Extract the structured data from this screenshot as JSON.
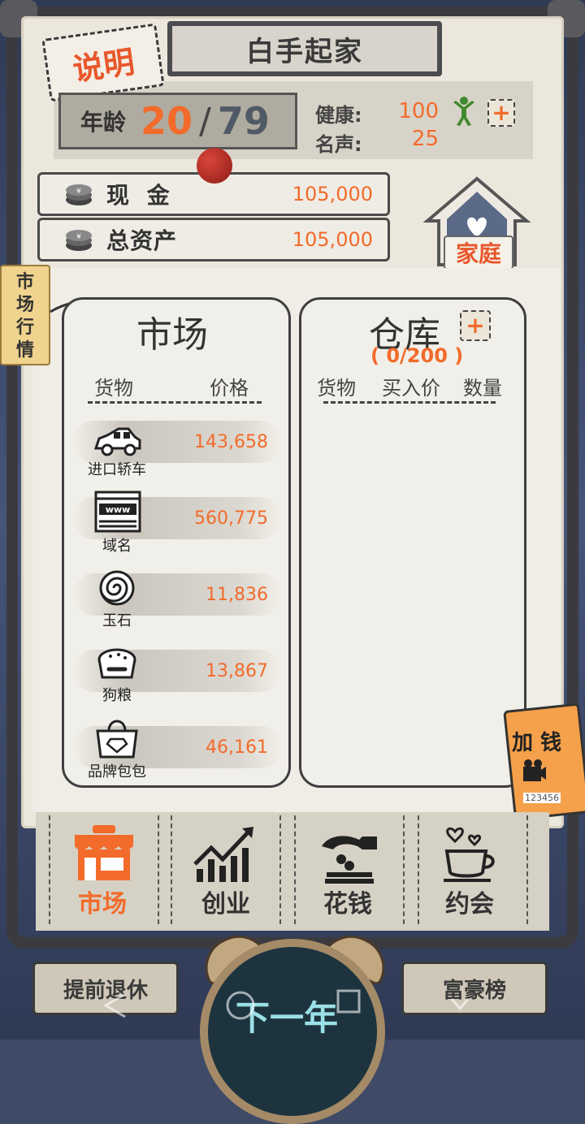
{
  "header": {
    "title": "白手起家",
    "info_button": "说明"
  },
  "stats": {
    "age_label": "年龄",
    "age": "20",
    "age_separator": "/",
    "age_max": "79",
    "health_label": "健康:",
    "health": "100",
    "fame_label": "名声:",
    "fame": "25",
    "health_plus": "+"
  },
  "finance": {
    "cash_label": "现 金",
    "cash": "105,000",
    "assets_label": "总资产",
    "assets": "105,000"
  },
  "family_button": "家庭",
  "side_tab": "市场行情",
  "market": {
    "title": "市场",
    "col_goods": "货物",
    "col_price": "价格",
    "items": [
      {
        "name": "进口轿车",
        "price": "143,658",
        "icon": "car-icon"
      },
      {
        "name": "域名",
        "price": "560,775",
        "icon": "www-icon"
      },
      {
        "name": "玉石",
        "price": "11,836",
        "icon": "jade-icon"
      },
      {
        "name": "狗粮",
        "price": "13,867",
        "icon": "dog-food-icon"
      },
      {
        "name": "品牌包包",
        "price": "46,161",
        "icon": "handbag-icon"
      }
    ]
  },
  "storage": {
    "title": "仓库",
    "plus": "+",
    "capacity": "( 0/200 )",
    "col_goods": "货物",
    "col_buy_price": "买入价",
    "col_quantity": "数量"
  },
  "add_money": {
    "label": "加 钱",
    "serial": "123456"
  },
  "tabs": [
    {
      "label": "市场",
      "icon": "shop-icon",
      "active": true
    },
    {
      "label": "创业",
      "icon": "chart-growth-icon",
      "active": false
    },
    {
      "label": "花钱",
      "icon": "spend-hand-icon",
      "active": false
    },
    {
      "label": "约会",
      "icon": "coffee-heart-icon",
      "active": false
    }
  ],
  "bottom": {
    "retire_button": "提前退休",
    "next_year_button": "下一年",
    "rich_list_button": "富豪榜"
  },
  "colors": {
    "accent": "#f26b2b",
    "paper": "#ebe7dc",
    "frame": "#3e4a66"
  }
}
